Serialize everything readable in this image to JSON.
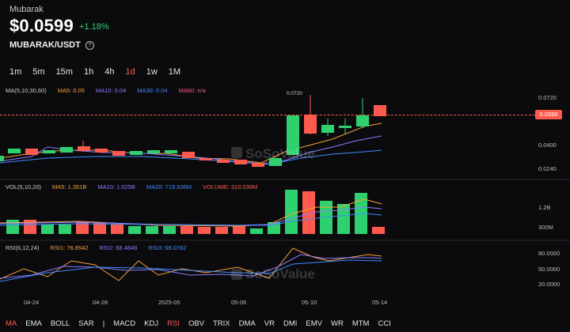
{
  "header": {
    "coin_name": "Mubarak",
    "price": "$0.0599",
    "change": "+1.18%",
    "pair": "MUBARAK/USDT"
  },
  "intervals": [
    {
      "label": "1m",
      "active": false
    },
    {
      "label": "5m",
      "active": false
    },
    {
      "label": "15m",
      "active": false
    },
    {
      "label": "1h",
      "active": false
    },
    {
      "label": "4h",
      "active": false
    },
    {
      "label": "1d",
      "active": true
    },
    {
      "label": "1w",
      "active": false
    },
    {
      "label": "1M",
      "active": false
    }
  ],
  "ma_legend": {
    "title": "MA(5,10,30,60)",
    "items": [
      {
        "label": "MA5: 0.05",
        "color": "#f6a03a"
      },
      {
        "label": "MA10: 0.04",
        "color": "#8a7dff"
      },
      {
        "label": "MA30: 0.04",
        "color": "#3d8bff"
      },
      {
        "label": "MA60: n/a",
        "color": "#ff5a8a"
      }
    ]
  },
  "vol_legend": {
    "title": "VOL(5,10,20)",
    "items": [
      {
        "label": "MA5: 1.351B",
        "color": "#f6a03a"
      },
      {
        "label": "MA10: 1.025B",
        "color": "#8a7dff"
      },
      {
        "label": "MA20: 719.936M",
        "color": "#3d8bff"
      },
      {
        "label": "VOLUME: 310.036M",
        "color": "#ff5a4e"
      }
    ]
  },
  "rsi_legend": {
    "title": "RSI(6,12,24)",
    "items": [
      {
        "label": "RSI1: 76.8542",
        "color": "#f6a03a"
      },
      {
        "label": "RSI2: 68.4848",
        "color": "#8a7dff"
      },
      {
        "label": "RSI3: 68.0782",
        "color": "#3d8bff"
      }
    ]
  },
  "price_axis": [
    "0.0720",
    "0.0400",
    "0.0240"
  ],
  "current_price_tag": "0.0599",
  "high_annotation": "0.0720",
  "vol_axis": [
    "1.2B",
    "300M"
  ],
  "rsi_axis": [
    "80.0000",
    "50.0000",
    "20.0000"
  ],
  "date_axis": [
    "04-24",
    "04-28",
    "2025-05",
    "05-06",
    "05-10",
    "05-14"
  ],
  "watermark": "SoSoValue",
  "indicators": [
    {
      "label": "MA",
      "active": true
    },
    {
      "label": "EMA",
      "active": false
    },
    {
      "label": "BOLL",
      "active": false
    },
    {
      "label": "SAR",
      "active": false
    },
    {
      "label": "|",
      "active": false
    },
    {
      "label": "MACD",
      "active": false
    },
    {
      "label": "KDJ",
      "active": false
    },
    {
      "label": "RSI",
      "active": true
    },
    {
      "label": "OBV",
      "active": false
    },
    {
      "label": "TRIX",
      "active": false
    },
    {
      "label": "DMA",
      "active": false
    },
    {
      "label": "VR",
      "active": false
    },
    {
      "label": "DMI",
      "active": false
    },
    {
      "label": "EMV",
      "active": false
    },
    {
      "label": "WR",
      "active": false
    },
    {
      "label": "MTM",
      "active": false
    },
    {
      "label": "CCI",
      "active": false
    }
  ],
  "colors": {
    "up": "#2fd16f",
    "down": "#ff5a4e",
    "accent": "#ff5a4e"
  }
}
